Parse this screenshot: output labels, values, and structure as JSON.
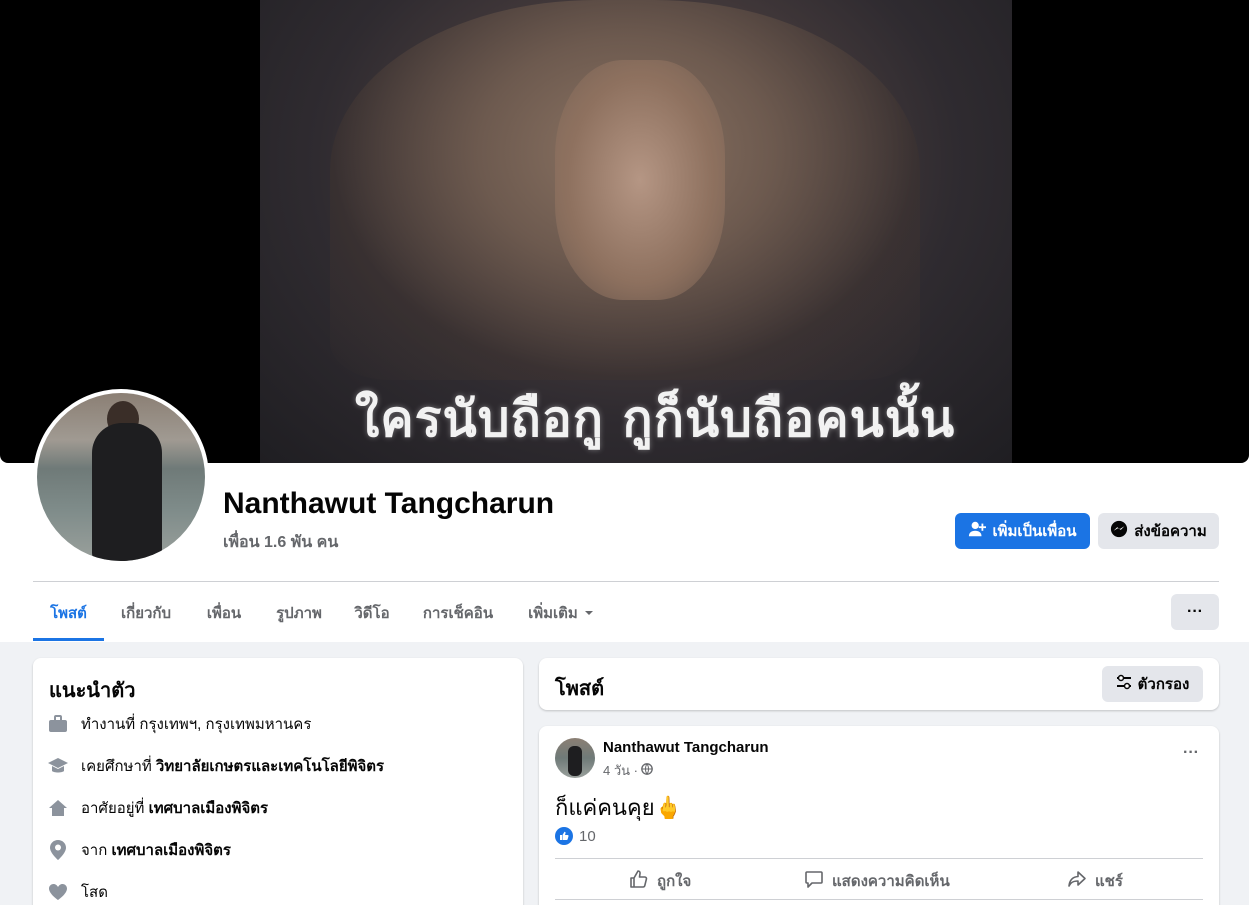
{
  "colors": {
    "accent": "#1b74e4",
    "page_bg": "#f0f2f5",
    "secondary_text": "#65676b",
    "button_gray": "#e4e6eb"
  },
  "cover": {
    "caption": "ใครนับถือกู กูก็นับถือคนนั้น"
  },
  "profile": {
    "name": "Nanthawut Tangcharun",
    "friends": "เพื่อน 1.6 พัน คน"
  },
  "actions": {
    "add_friend": "เพิ่มเป็นเพื่อน",
    "message": "ส่งข้อความ"
  },
  "tabs": [
    {
      "label": "โพสต์",
      "active": true
    },
    {
      "label": "เกี่ยวกับ"
    },
    {
      "label": "เพื่อน"
    },
    {
      "label": "รูปภาพ"
    },
    {
      "label": "วิดีโอ"
    },
    {
      "label": "การเช็คอิน"
    },
    {
      "label": "เพิ่มเติม"
    }
  ],
  "more_menu": "···",
  "intro": {
    "title": "แนะนำตัว",
    "rows": [
      {
        "icon": "briefcase-icon",
        "prefix": "ทำงานที่ กรุงเทพฯ, กรุงเทพมหานคร",
        "bold": ""
      },
      {
        "icon": "graduation-cap-icon",
        "prefix": "เคยศึกษาที่ ",
        "bold": "วิทยาลัยเกษตรและเทคโนโลยีพิจิตร"
      },
      {
        "icon": "home-icon",
        "prefix": "อาศัยอยู่ที่ ",
        "bold": "เทศบาลเมืองพิจิตร"
      },
      {
        "icon": "location-pin-icon",
        "prefix": "จาก ",
        "bold": "เทศบาลเมืองพิจิตร"
      },
      {
        "icon": "heart-icon",
        "prefix": "โสด",
        "bold": ""
      }
    ]
  },
  "posts_section": {
    "title": "โพสต์",
    "filter": "ตัวกรอง"
  },
  "post": {
    "author": "Nanthawut Tangcharun",
    "time": "4 วัน ·",
    "text": "ก็แค่คนคุย🖕",
    "likes": "10",
    "like_label": "ถูกใจ",
    "comment_label": "แสดงความคิดเห็น",
    "share_label": "แชร์",
    "menu": "···"
  }
}
